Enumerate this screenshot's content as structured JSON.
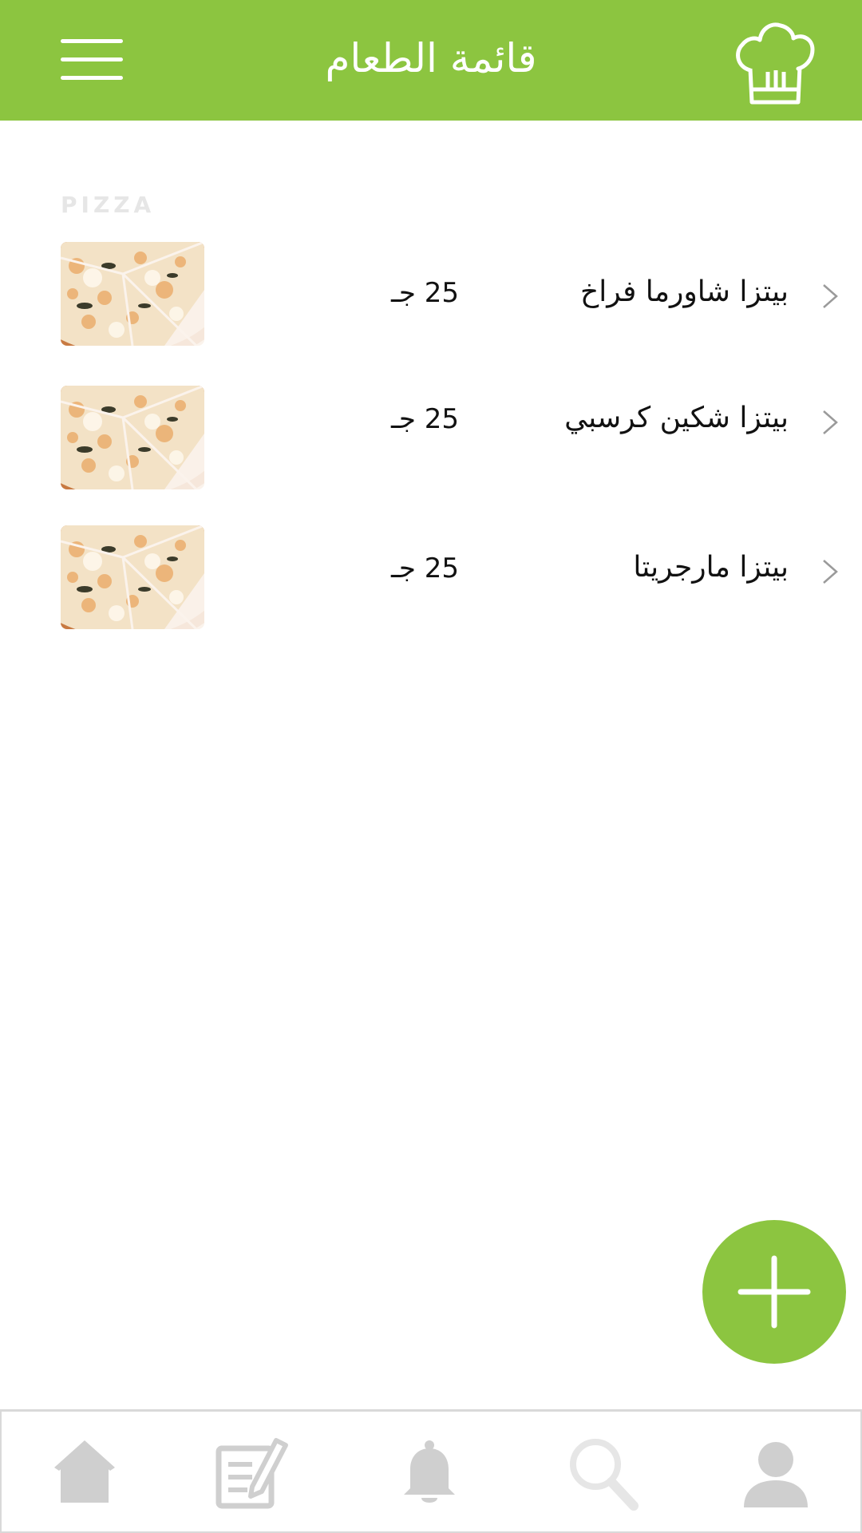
{
  "header": {
    "title": "قائمة الطعام",
    "menu_icon": "hamburger-menu-icon",
    "chef_icon": "chef-hat-icon",
    "background_color": "#8cc540"
  },
  "section": {
    "label": "PIZZA"
  },
  "items": [
    {
      "name": "بيتزا شاورما فراخ",
      "price": "25 جـ",
      "image": "pizza-thumbnail"
    },
    {
      "name": "بيتزا شكين كرسبي",
      "price": "25 جـ",
      "image": "pizza-thumbnail"
    },
    {
      "name": "بيتزا مارجريتا",
      "price": "25 جـ",
      "image": "pizza-thumbnail"
    }
  ],
  "fab": {
    "icon": "plus-icon",
    "color": "#8cc540"
  },
  "bottom_nav": [
    {
      "icon": "home-icon"
    },
    {
      "icon": "edit-note-icon"
    },
    {
      "icon": "bell-icon"
    },
    {
      "icon": "search-icon"
    },
    {
      "icon": "user-icon"
    }
  ],
  "colors": {
    "accent": "#8cc540",
    "nav_icon": "#cfcfcf"
  }
}
